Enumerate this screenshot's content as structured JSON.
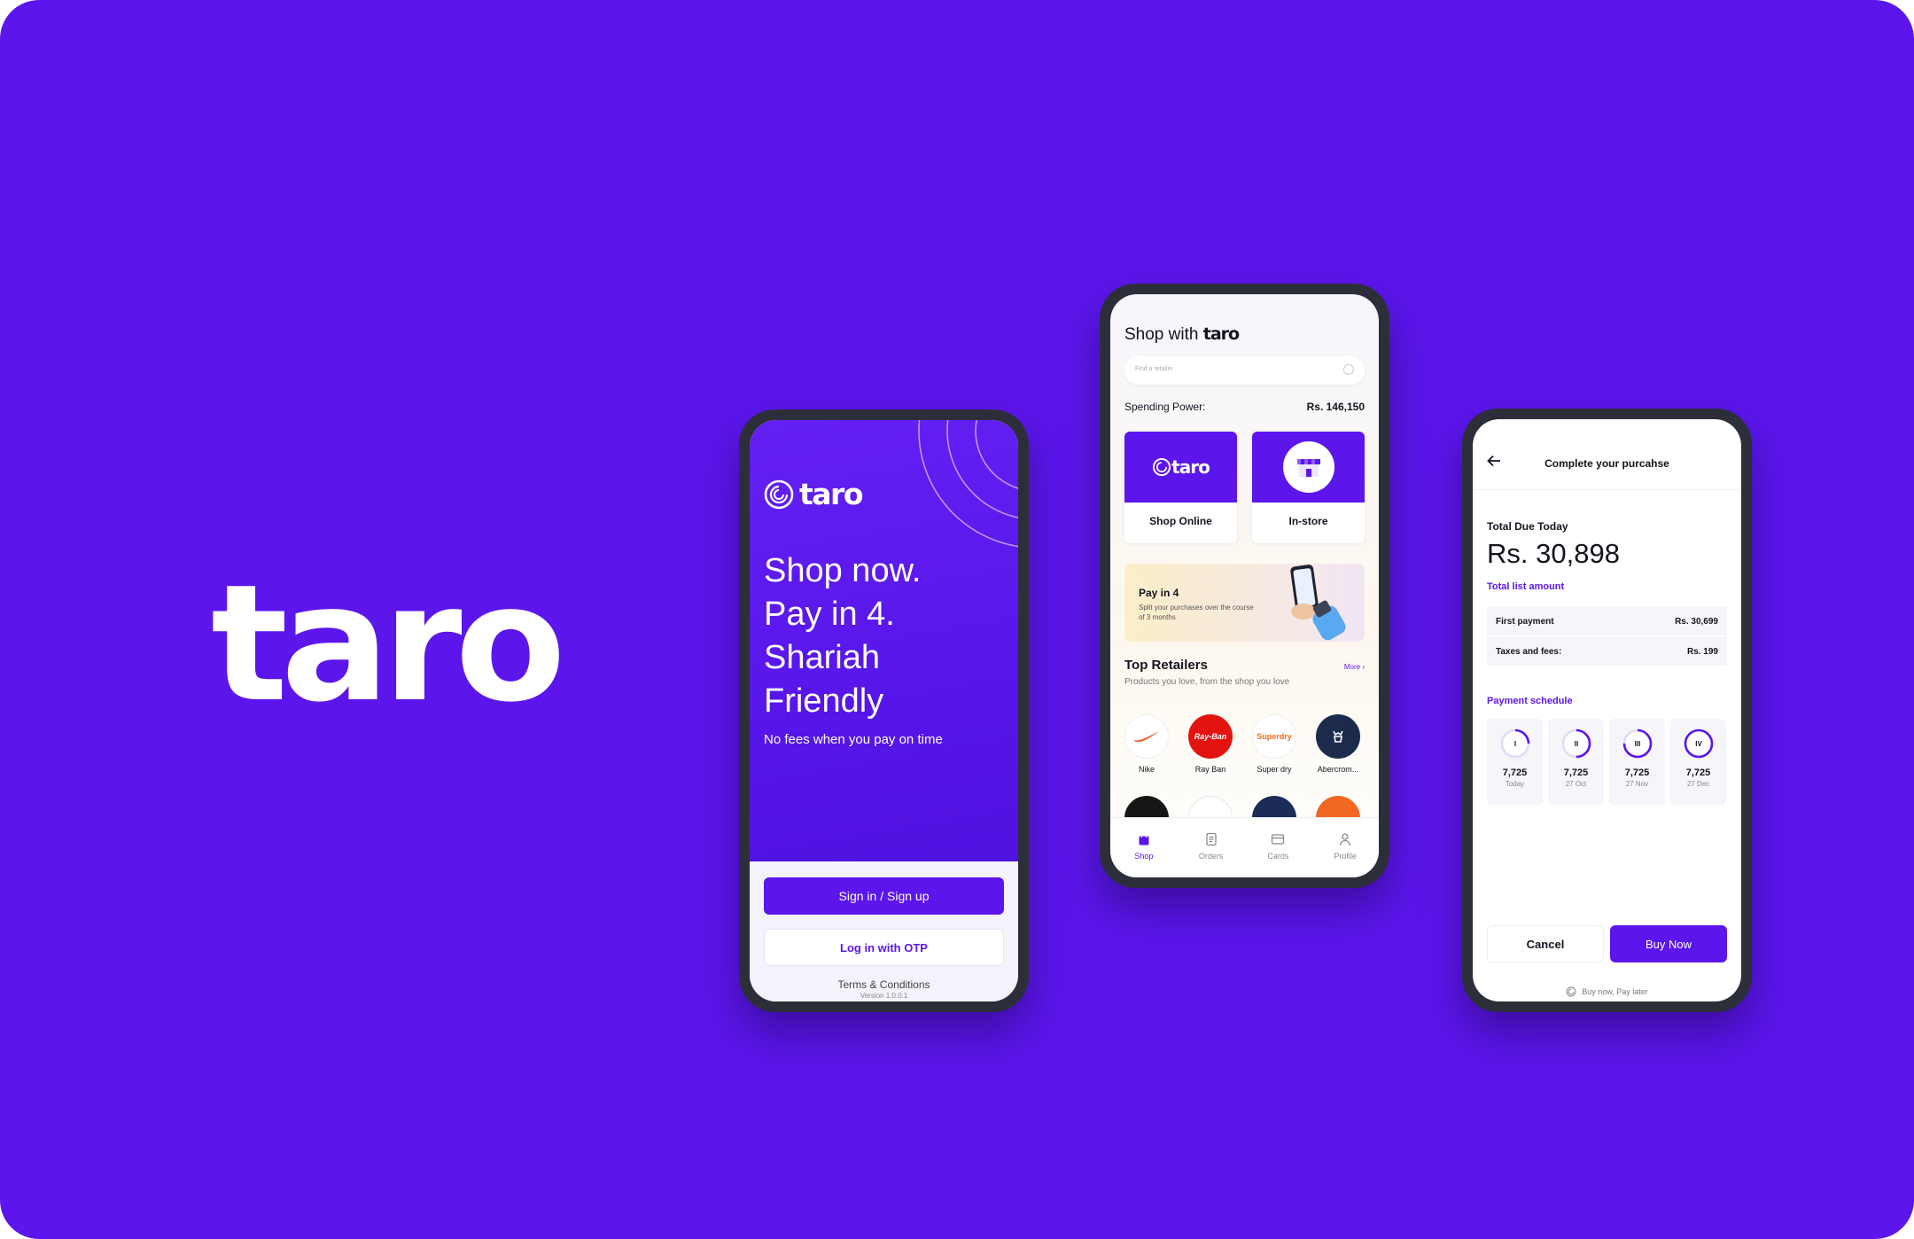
{
  "brand": {
    "wordmark": "taro"
  },
  "colors": {
    "accent": "#5c16ec",
    "background": "#5c16ec"
  },
  "welcome": {
    "logo": "taro",
    "headline": [
      "Shop now.",
      "Pay in 4.",
      "Shariah",
      "Friendly"
    ],
    "subtext": "No fees when you pay on time",
    "signin_label": "Sign in / Sign up",
    "otp_label": "Log in with OTP",
    "terms_label": "Terms & Conditions",
    "version": "Version 1.0.0.1"
  },
  "shop": {
    "title_prefix": "Shop with",
    "title_brand": "taro",
    "search_placeholder": "Find a retailer",
    "spending_label": "Spending Power:",
    "spending_value": "Rs. 146,150",
    "cards": [
      {
        "label": "Shop Online",
        "logo": "taro"
      },
      {
        "label": "In-store",
        "icon": "store-icon"
      }
    ],
    "banner": {
      "title": "Pay in 4",
      "subtitle": "Split your purchases over the course of 3 months"
    },
    "retailers_title": "Top Retailers",
    "retailers_more": "More ›",
    "retailers_sub": "Products you love, from the shop you love",
    "retailers": [
      {
        "name": "Nike",
        "logo_text": ""
      },
      {
        "name": "Ray Ban",
        "logo_text": "Ray-Ban"
      },
      {
        "name": "Super dry",
        "logo_text": "Superdry"
      },
      {
        "name": "Abercrom...",
        "logo_text": ""
      }
    ],
    "tabs": [
      {
        "label": "Shop",
        "icon": "shopping-bag-icon",
        "active": true
      },
      {
        "label": "Orders",
        "icon": "orders-icon",
        "active": false
      },
      {
        "label": "Cards",
        "icon": "card-icon",
        "active": false
      },
      {
        "label": "Profile",
        "icon": "profile-icon",
        "active": false
      }
    ]
  },
  "checkout": {
    "title": "Complete your purcahse",
    "due_label": "Total Due Today",
    "due_value": "Rs. 30,898",
    "list_label": "Total list amount",
    "rows": [
      {
        "label": "First payment",
        "value": "Rs. 30,699"
      },
      {
        "label": "Taxes and fees:",
        "value": "Rs. 199"
      }
    ],
    "schedule_label": "Payment schedule",
    "installments": [
      {
        "numeral": "I",
        "amount": "7,725",
        "date": "Today",
        "progress": 0.25
      },
      {
        "numeral": "II",
        "amount": "7,725",
        "date": "27 Oct",
        "progress": 0.5
      },
      {
        "numeral": "III",
        "amount": "7,725",
        "date": "27 Nov",
        "progress": 0.75
      },
      {
        "numeral": "IV",
        "amount": "7,725",
        "date": "27 Dec",
        "progress": 1.0
      }
    ],
    "cancel_label": "Cancel",
    "buy_label": "Buy Now",
    "footer": "Buy now, Pay later"
  }
}
